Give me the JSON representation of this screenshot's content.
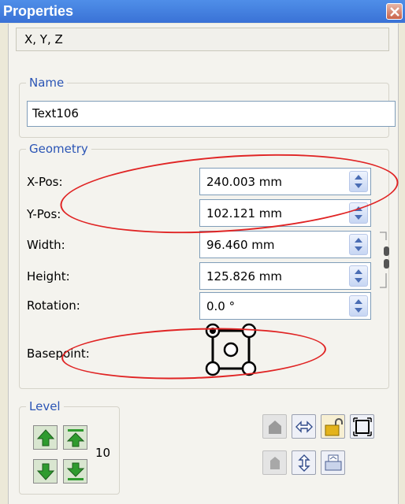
{
  "window": {
    "title": "Properties"
  },
  "xyz_label": "X, Y, Z",
  "name_group": {
    "title": "Name",
    "value": "Text106"
  },
  "geometry": {
    "title": "Geometry",
    "x_pos": {
      "label": "X-Pos:",
      "value": "240.003 mm"
    },
    "y_pos": {
      "label": "Y-Pos:",
      "value": "102.121 mm"
    },
    "width": {
      "label": "Width:",
      "value": "96.460 mm"
    },
    "height": {
      "label": "Height:",
      "value": "125.826 mm"
    },
    "rotation": {
      "label": "Rotation:",
      "value": "0.0 °"
    },
    "basepoint": {
      "label": "Basepoint:",
      "selected": "top-left"
    }
  },
  "level": {
    "title": "Level",
    "value": "10"
  },
  "icons": {
    "close": "close-icon",
    "spin": "spin-arrows-icon",
    "chain": "chain-link-icon",
    "raise_top": "raise-to-top-icon",
    "raise": "raise-one-level-icon",
    "lower": "lower-one-level-icon",
    "lower_bottom": "lower-to-bottom-icon"
  },
  "colors": {
    "title_bar": "#3a72d6",
    "group_title": "#2b55b5",
    "annotation_oval": "#e02424"
  }
}
